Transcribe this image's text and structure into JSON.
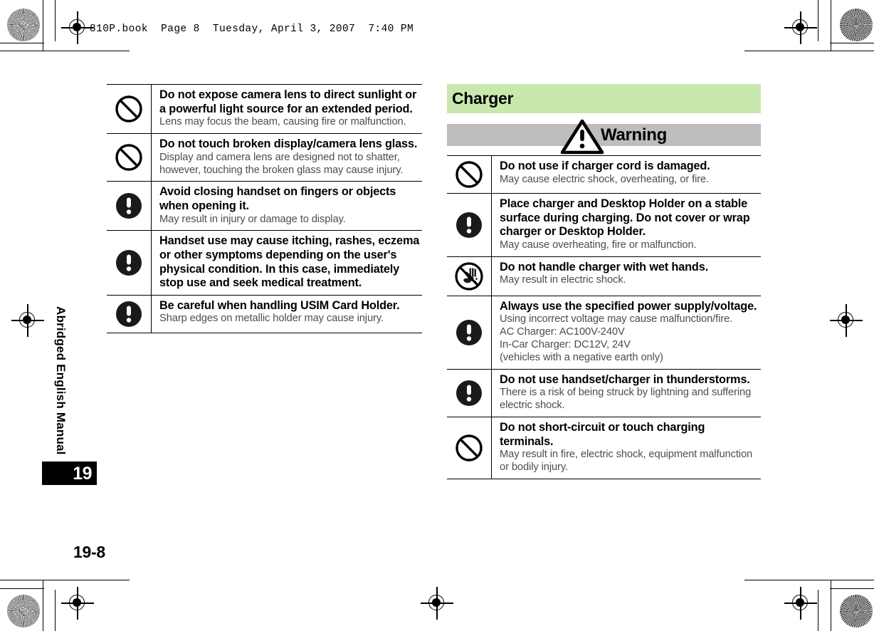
{
  "header": {
    "book_line": "810P.book  Page 8  Tuesday, April 3, 2007  7:40 PM"
  },
  "sidebar": {
    "manual_label": "Abridged English Manual",
    "chapter_tab": "19"
  },
  "footer": {
    "page_number": "19-8"
  },
  "colors": {
    "section_header_bg": "#c8e8ae",
    "warning_bar_bg": "#bdbdbd",
    "heading_text": "#000000",
    "description_text": "#4d4d4d",
    "tab_bg": "#000000"
  },
  "left_column": {
    "rows": [
      {
        "icon": "prohibition-icon",
        "heading": "Do not expose camera lens to direct sunlight or a powerful light source for an extended period.",
        "description": "Lens may focus the beam, causing fire or malfunction."
      },
      {
        "icon": "prohibition-icon",
        "heading": "Do not touch broken display/camera lens glass.",
        "description": "Display and camera lens are designed not to shatter, however, touching the broken glass may cause injury."
      },
      {
        "icon": "mandatory-icon",
        "heading": "Avoid closing handset on fingers or objects when opening it.",
        "description": "May result in injury or damage to display."
      },
      {
        "icon": "mandatory-icon",
        "heading": "Handset use may cause itching, rashes, eczema or other symptoms depending on the user's physical condition. In this case, immediately stop use and seek medical treatment.",
        "description": ""
      },
      {
        "icon": "mandatory-icon",
        "heading": "Be careful when handling USIM Card Holder.",
        "description": "Sharp edges on metallic holder may cause injury."
      }
    ]
  },
  "right_column": {
    "section_title": "Charger",
    "warning_label": "Warning",
    "warning_icon": "warning-triangle-icon",
    "rows": [
      {
        "icon": "prohibition-icon",
        "heading": "Do not use if charger cord is damaged.",
        "description": "May cause electric shock, overheating, or fire."
      },
      {
        "icon": "mandatory-icon",
        "heading": "Place charger and Desktop Holder on a stable surface during charging. Do not cover or wrap charger or Desktop Holder.",
        "description": "May cause overheating, fire or malfunction."
      },
      {
        "icon": "no-wet-hands-icon",
        "heading": "Do not handle charger with wet hands.",
        "description": "May result in electric shock."
      },
      {
        "icon": "mandatory-icon",
        "heading": "Always use the specified power supply/voltage.",
        "description": "Using incorrect voltage may cause malfunction/fire.\nAC Charger: AC100V-240V\nIn-Car Charger: DC12V, 24V\n(vehicles with a negative earth only)"
      },
      {
        "icon": "mandatory-icon",
        "heading": "Do not use handset/charger in thunderstorms.",
        "description": "There is a risk of being struck by lightning and suffering electric shock."
      },
      {
        "icon": "prohibition-icon",
        "heading": "Do not short-circuit or touch charging terminals.",
        "description": "May result in fire, electric shock, equipment malfunction or bodily injury."
      }
    ]
  }
}
